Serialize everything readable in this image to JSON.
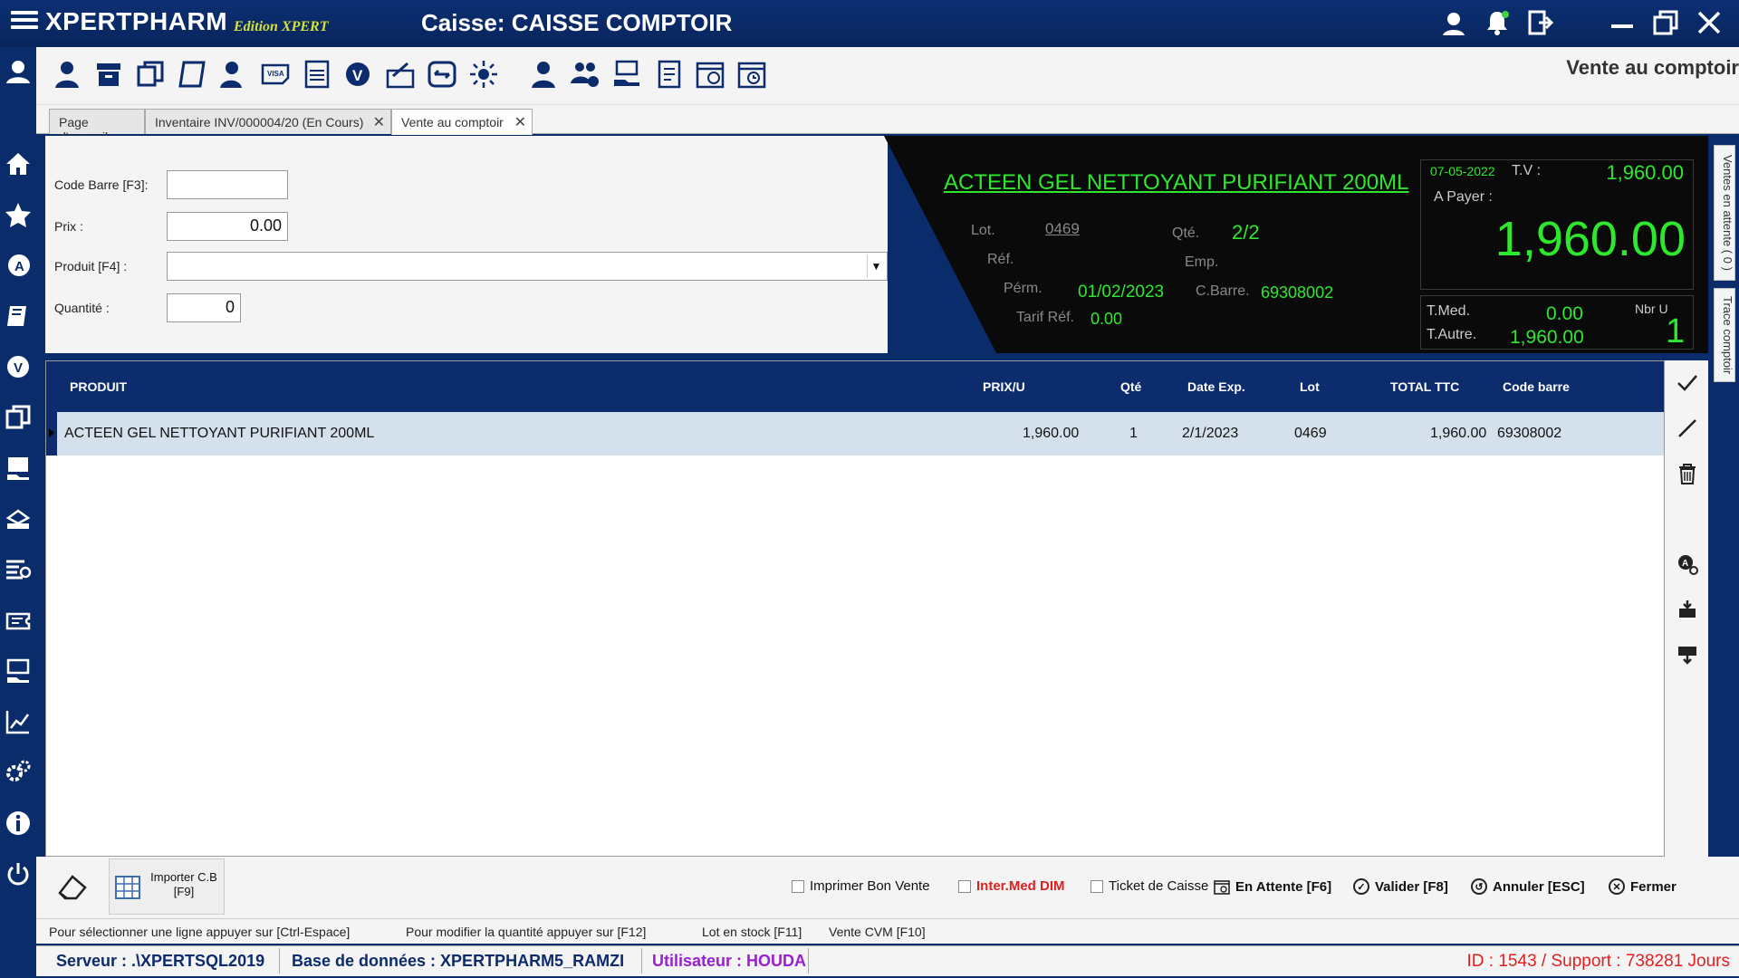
{
  "titlebar": {
    "brand": "XPERTPHARM",
    "edition": "Edition XPERT",
    "caisse_title": "Caisse: CAISSE COMPTOIR"
  },
  "toolbar": {
    "page_title": "Vente au comptoir"
  },
  "tabs": [
    {
      "label": "Page d'accueil",
      "closable": false
    },
    {
      "label": "Inventaire INV/000004/20 (En Cours)",
      "closable": true
    },
    {
      "label": "Vente au comptoir",
      "closable": true,
      "active": true
    }
  ],
  "form": {
    "code_barre_label": "Code Barre [F3]:",
    "code_barre_value": "",
    "prix_label": "Prix :",
    "prix_value": "0.00",
    "produit_label": "Produit [F4] :",
    "produit_value": "",
    "quantite_label": "Quantité :",
    "quantite_value": "0"
  },
  "info": {
    "product_name": "ACTEEN GEL NETTOYANT PURIFIANT 200ML",
    "lot_label": "Lot.",
    "lot_value": "0469",
    "qte_label": "Qté.",
    "qte_value": "2/2",
    "ref_label": "Réf.",
    "emp_label": "Emp.",
    "perm_label": "Pérm.",
    "perm_value": "01/02/2023",
    "cbarre_label": "C.Barre.",
    "cbarre_value": "69308002",
    "tarif_label": "Tarif Réf.",
    "tarif_value": "0.00",
    "date": "07-05-2022",
    "tv_label": "T.V :",
    "tv_value": "1,960.00",
    "apayer_label": "A Payer :",
    "apayer_value": "1,960.00",
    "tmed_label": "T.Med.",
    "tmed_value": "0.00",
    "nbru_label": "Nbr U",
    "nbru_value": "1",
    "tautre_label": "T.Autre.",
    "tautre_value": "1,960.00"
  },
  "side_tabs": {
    "ventes_attente": "Ventes en attente ( 0 )",
    "trace_comptoir": "Trace comptoir"
  },
  "grid": {
    "columns": [
      "PRODUIT",
      "PRIX/U",
      "Qté",
      "Date Exp.",
      "Lot",
      "TOTAL TTC",
      "Code barre"
    ],
    "rows": [
      {
        "produit": "ACTEEN GEL NETTOYANT PURIFIANT 200ML",
        "prix": "1,960.00",
        "qte": "1",
        "date_exp": "2/1/2023",
        "lot": "0469",
        "total": "1,960.00",
        "code_barre": "69308002"
      }
    ]
  },
  "actions": {
    "import_label": "Importer C.B",
    "import_key": "[F9]",
    "imprimer": "Imprimer Bon Vente",
    "inter_med": "Inter.Med DIM",
    "ticket": "Ticket de Caisse",
    "attente": "En Attente [F6]",
    "valider": "Valider [F8]",
    "annuler": "Annuler [ESC]",
    "fermer": "Fermer"
  },
  "hints": {
    "h1": "Pour sélectionner une ligne appuyer sur [Ctrl-Espace]",
    "h2": "Pour modifier la quantité appuyer sur [F12]",
    "h3": "Lot en stock [F11]",
    "h4": "Vente CVM [F10]"
  },
  "status": {
    "serveur": "Serveur : .\\XPERTSQL2019",
    "base": "Base de données : XPERTPHARM5_RAMZI",
    "utilisateur": "Utilisateur : HOUDA",
    "support": "ID : 1543 / Support : 738281 Jours"
  },
  "colors": {
    "navy": "#0c2c6e",
    "green_text": "#2ee82e",
    "edition_yellow": "#d2e23a",
    "red": "#e02020",
    "purple": "#9b1fd1"
  }
}
